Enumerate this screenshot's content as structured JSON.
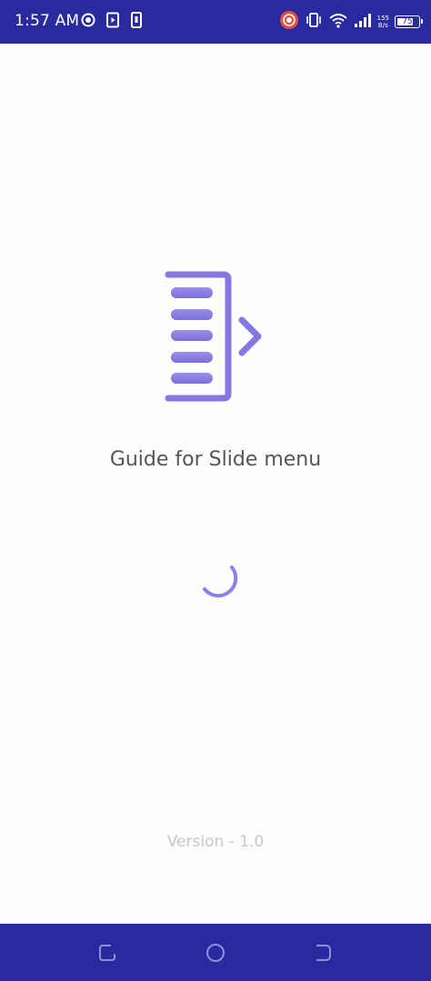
{
  "status_bar": {
    "time": "1:57 AM",
    "network_speed_value": "155",
    "network_speed_unit": "B/s",
    "battery_level": "75",
    "background_color": "#2a2a9f"
  },
  "main": {
    "title": "Guide for Slide menu",
    "version": "Version - 1.0",
    "logo_icon": "slide-menu-icon",
    "accent_color": "#8377e0"
  },
  "nav_bar": {
    "buttons": [
      "recents",
      "home",
      "back"
    ]
  }
}
